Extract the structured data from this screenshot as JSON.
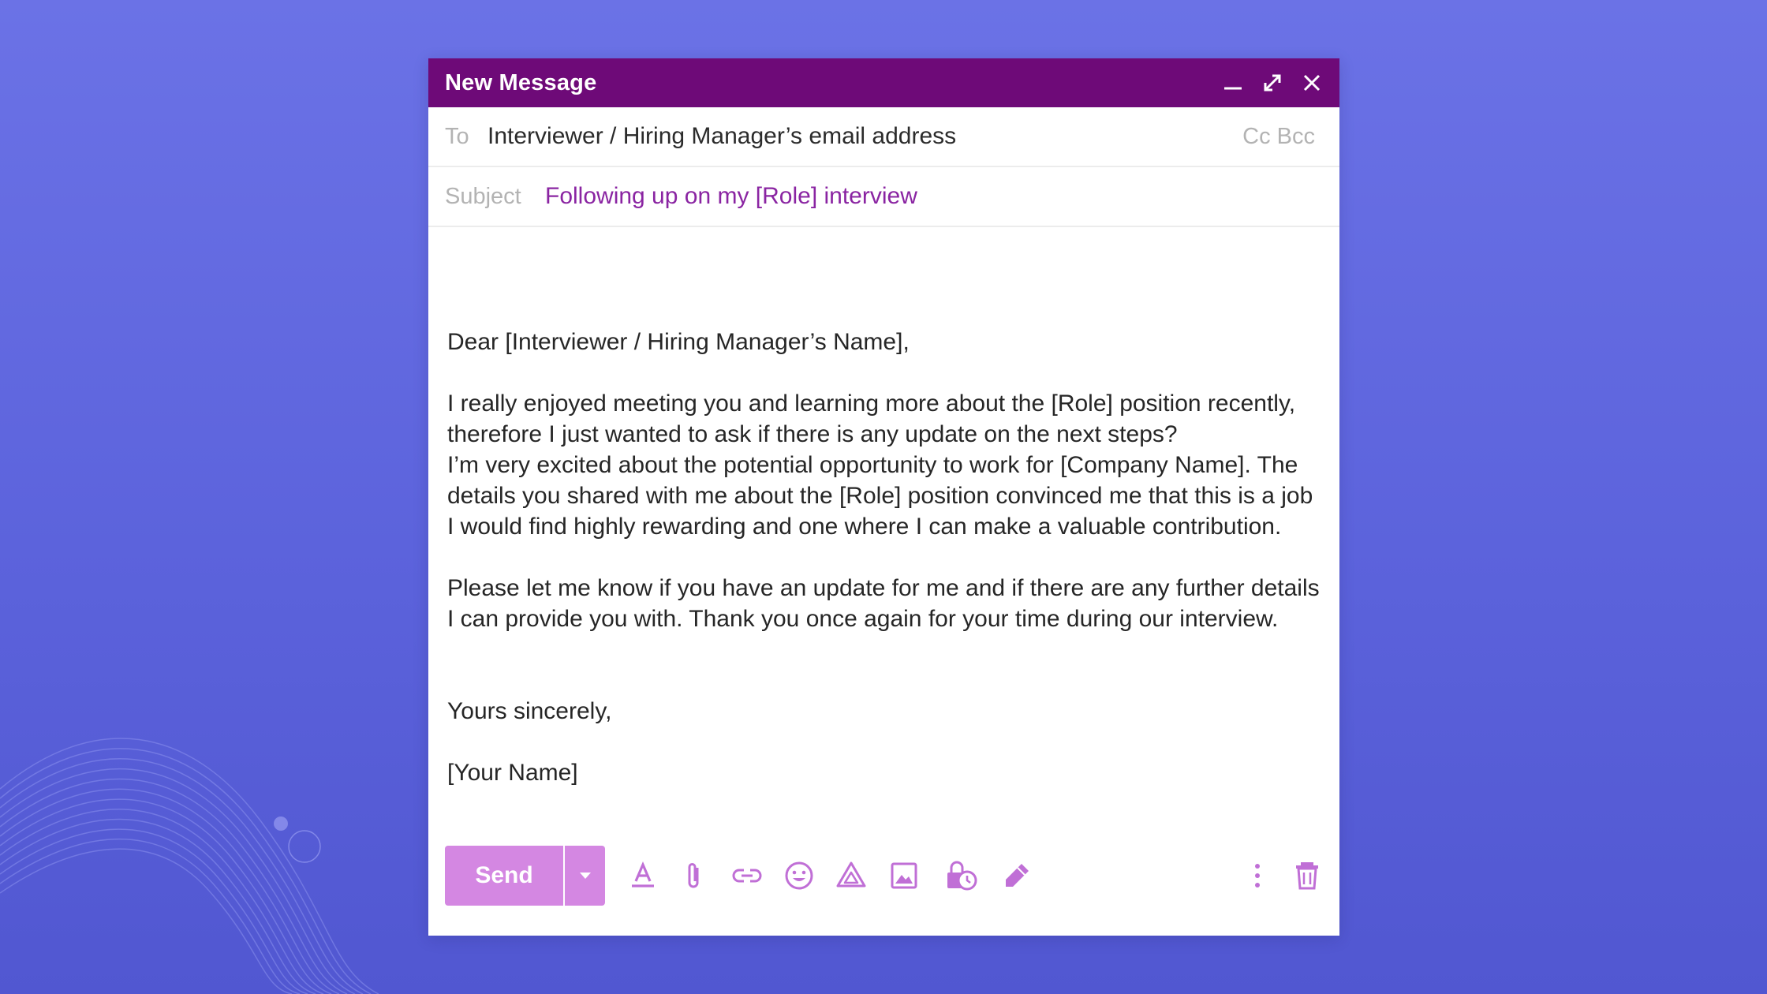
{
  "colors": {
    "background": "#6068e0",
    "titlebar": "#6e0a78",
    "accent": "#8a24a2",
    "send_button": "#d487e2",
    "icon": "#c06fd6"
  },
  "window": {
    "title": "New Message",
    "controls": [
      "minimize-icon",
      "expand-icon",
      "close-icon"
    ]
  },
  "to": {
    "label": "To",
    "value": "Interviewer / Hiring Manager’s email address",
    "cc": "Cc",
    "bcc": "Bcc"
  },
  "subject": {
    "label": "Subject",
    "value": "Following up on my [Role] interview"
  },
  "body": {
    "greeting": "Dear [Interviewer / Hiring Manager’s Name],",
    "paragraph1": "I really enjoyed meeting you and learning more about the [Role] position recently, therefore I just wanted to ask if there is any update on the next steps?",
    "paragraph2": "I’m very excited about the potential opportunity to work for [Company Name]. The details you shared with me about the [Role] position convinced me that this is a job I would find highly rewarding and one where I can make a valuable contribution.",
    "paragraph3": "Please let me know if you have an update for me and if there are any further details I can provide you with. Thank you once again for your time during our interview.",
    "closing": "Yours sincerely,",
    "signature": "[Your Name]"
  },
  "toolbar": {
    "send_label": "Send",
    "icons": [
      "text-format-icon",
      "attachment-icon",
      "link-icon",
      "emoji-icon",
      "drive-icon",
      "image-icon",
      "confidential-mode-icon",
      "signature-icon",
      "more-options-icon",
      "trash-icon"
    ]
  }
}
